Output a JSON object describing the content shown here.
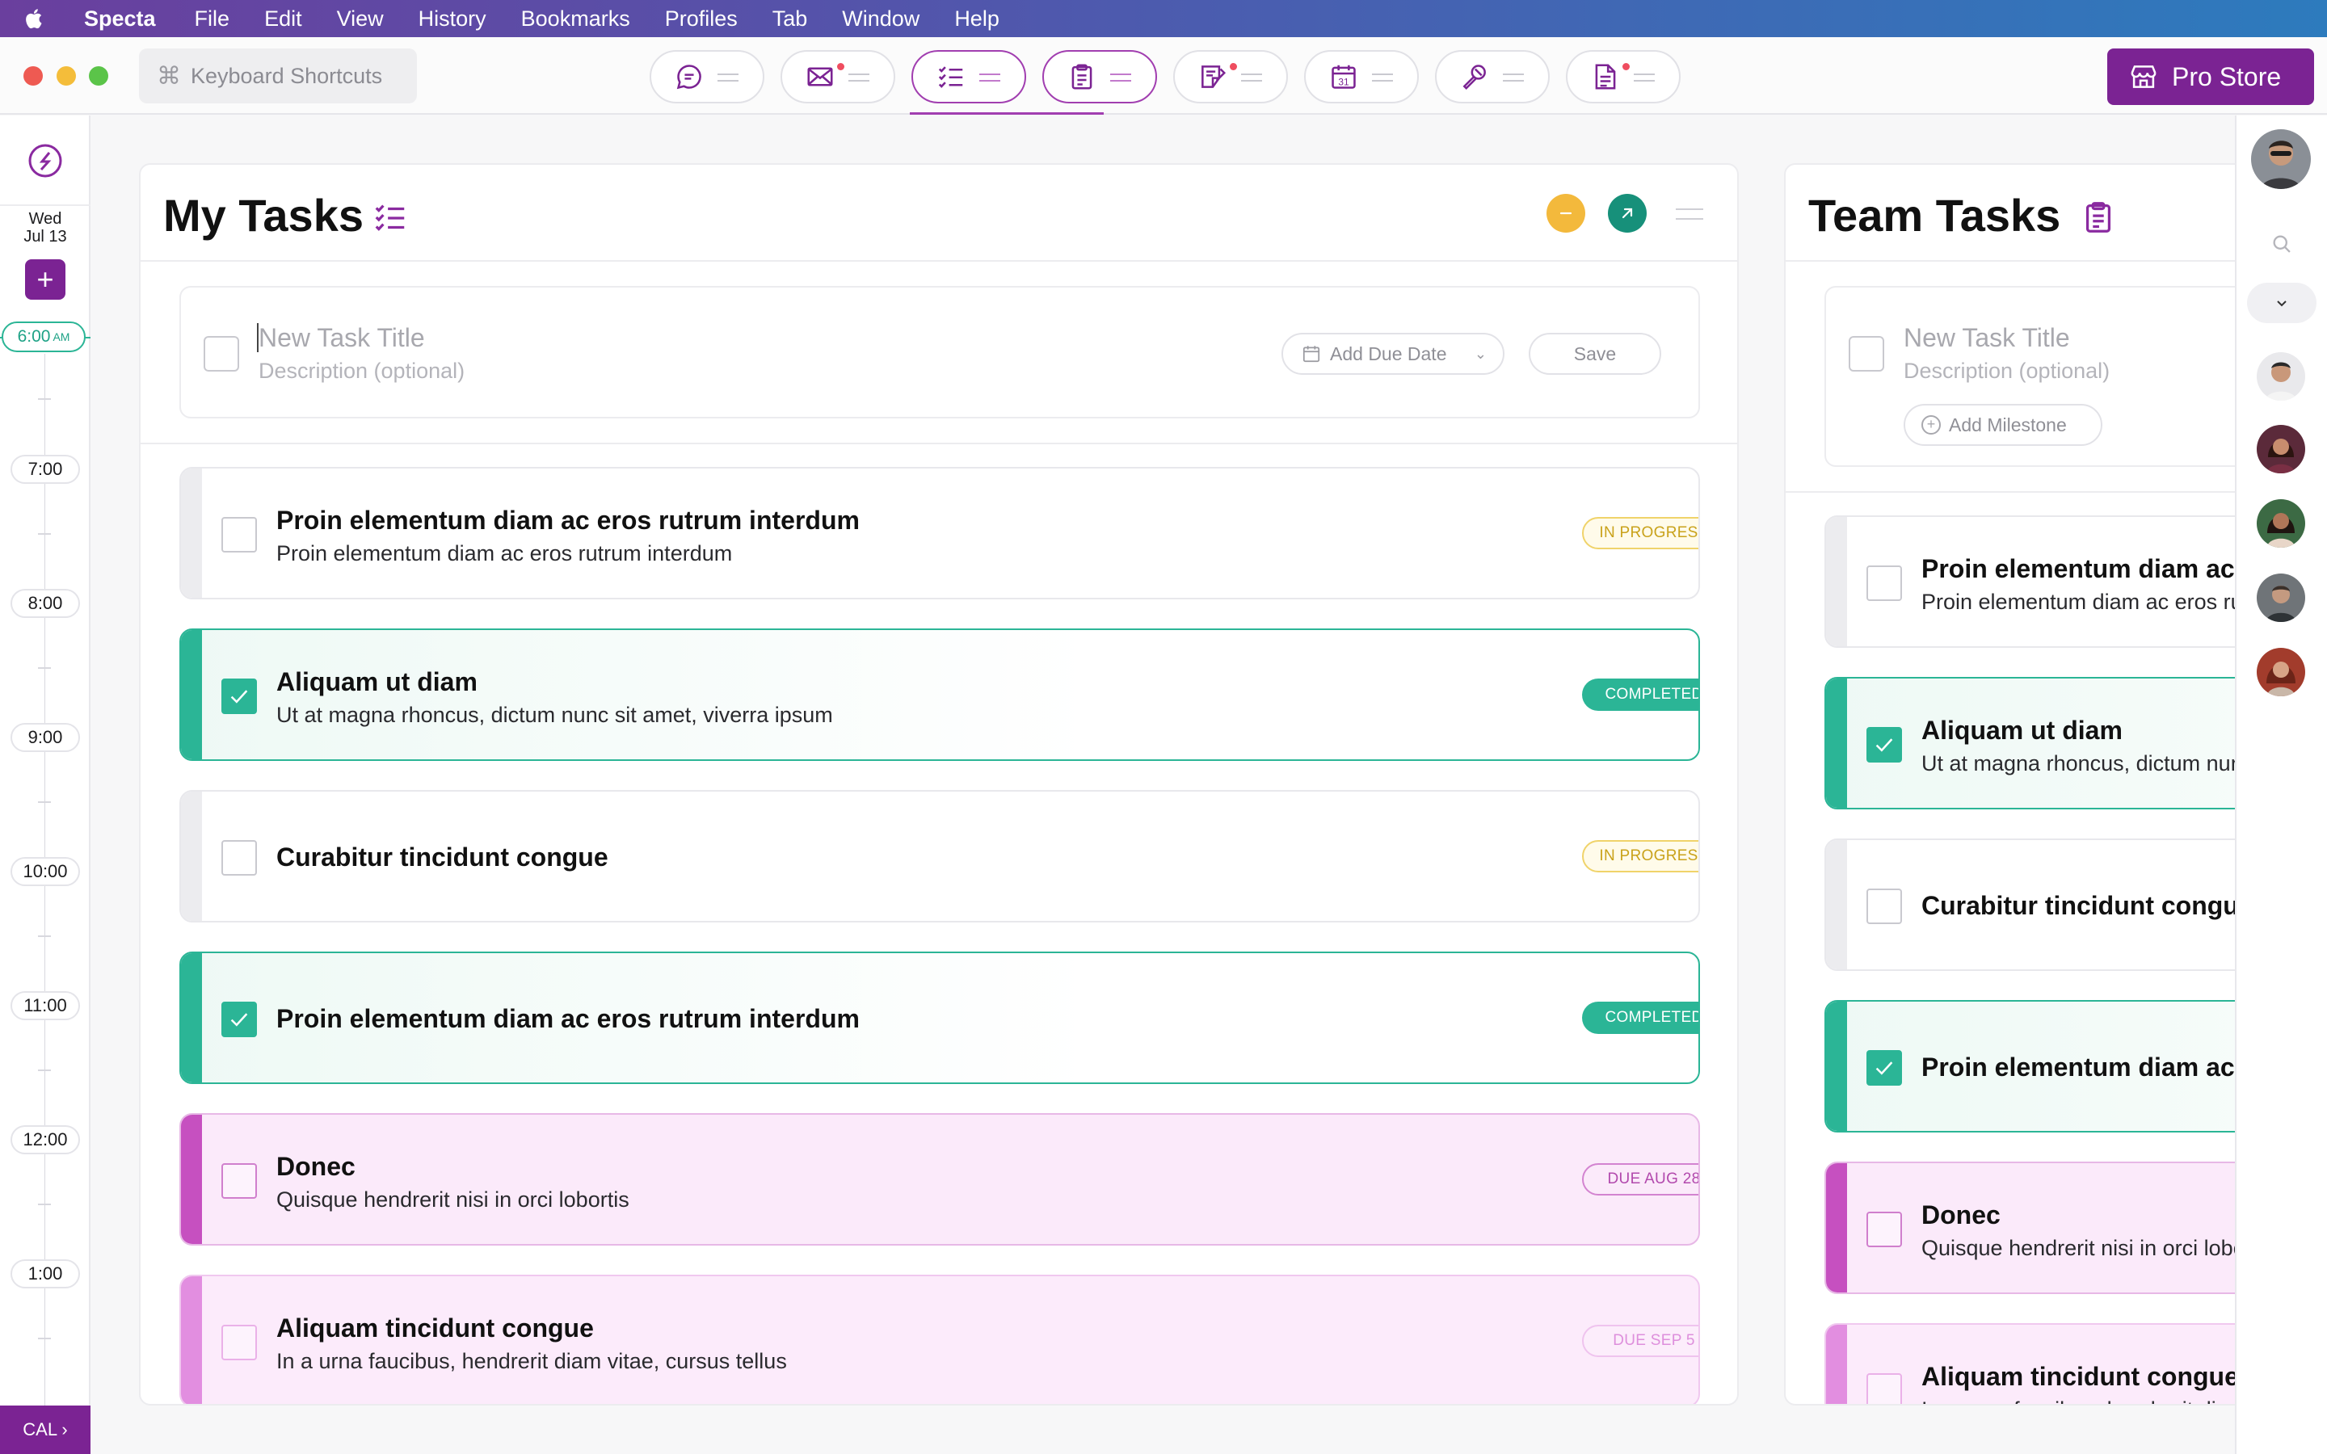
{
  "menubar": {
    "app": "Specta",
    "items": [
      "File",
      "Edit",
      "View",
      "History",
      "Bookmarks",
      "Profiles",
      "Tab",
      "Window",
      "Help"
    ]
  },
  "toolbar": {
    "shortcut_label": "Keyboard Shortcuts",
    "tabs": [
      {
        "icon": "chat-bubble-icon",
        "active": false,
        "notify": false
      },
      {
        "icon": "mail-icon",
        "active": false,
        "notify": true
      },
      {
        "icon": "checklist-icon",
        "active": true,
        "notify": false
      },
      {
        "icon": "clipboard-icon",
        "active": true,
        "notify": false
      },
      {
        "icon": "note-icon",
        "active": false,
        "notify": true
      },
      {
        "icon": "calendar-icon",
        "active": false,
        "notify": false
      },
      {
        "icon": "microphone-icon",
        "active": false,
        "notify": false
      },
      {
        "icon": "document-icon",
        "active": false,
        "notify": true
      }
    ],
    "pro_store_label": "Pro Store"
  },
  "calendar_rail": {
    "weekday": "Wed",
    "date": "Jul 13",
    "add_label": "+",
    "now_time": "6:00",
    "now_suffix": "AM",
    "hours": [
      "7:00",
      "8:00",
      "9:00",
      "10:00",
      "11:00",
      "12:00",
      "1:00"
    ],
    "cal_label": "CAL ›"
  },
  "my_tasks": {
    "title": "My Tasks",
    "composer": {
      "title_placeholder": "New Task Title",
      "desc_placeholder": "Description (optional)",
      "due_label": "Add Due Date",
      "save_label": "Save"
    },
    "tasks": [
      {
        "title": "Proin elementum diam ac eros rutrum interdum",
        "desc": "Proin elementum diam ac eros rutrum interdum",
        "status": "IN PROGRESS",
        "kind": "progress"
      },
      {
        "title": "Aliquam ut diam",
        "desc": "Ut at magna rhoncus, dictum nunc sit amet, viverra ipsum",
        "status": "COMPLETED",
        "kind": "done"
      },
      {
        "title": "Curabitur tincidunt congue",
        "desc": "",
        "status": "IN PROGRESS",
        "kind": "progress"
      },
      {
        "title": "Proin elementum diam ac eros rutrum interdum",
        "desc": "",
        "status": "COMPLETED",
        "kind": "done"
      },
      {
        "title": "Donec",
        "desc": "Quisque hendrerit nisi in orci lobortis",
        "status": "DUE AUG 28",
        "kind": "due"
      },
      {
        "title": "Aliquam tincidunt congue",
        "desc": "In a urna faucibus, hendrerit diam vitae, cursus tellus",
        "status": "DUE SEP 5",
        "kind": "due2"
      }
    ]
  },
  "team_tasks": {
    "title": "Team Tasks",
    "composer": {
      "title_placeholder": "New Task Title",
      "desc_placeholder": "Description (optional)",
      "milestone_label": "Add Milestone"
    }
  },
  "colors": {
    "accent": "#7b2393",
    "completed": "#2bb596",
    "progress": "#f0d36a",
    "due": "#c650c0"
  }
}
